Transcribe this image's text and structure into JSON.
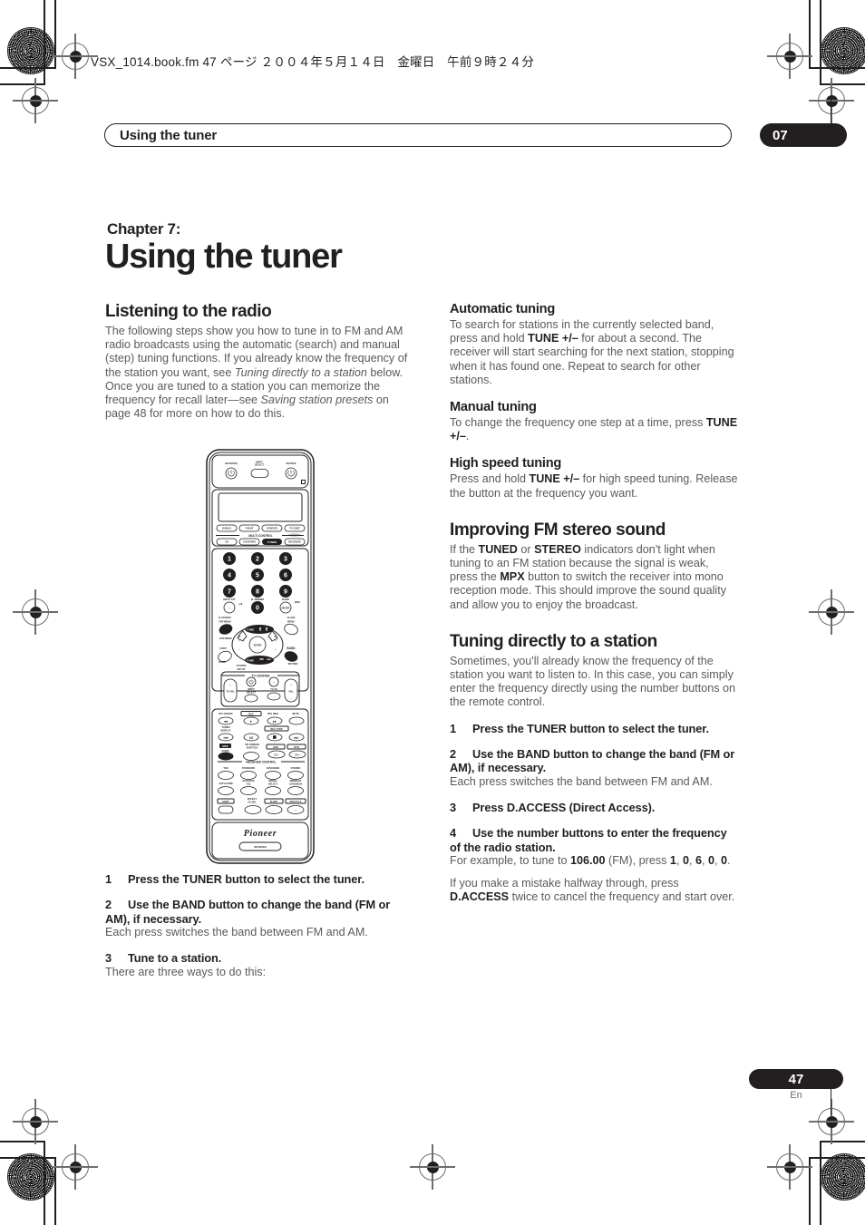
{
  "slug": {
    "text": "VSX_1014.book.fm  47 ページ  ２００４年５月１４日　金曜日　午前９時２４分"
  },
  "running_head": {
    "title": "Using the tuner",
    "chapter_number": "07"
  },
  "chapter": {
    "label": "Chapter 7:",
    "title": "Using the tuner"
  },
  "left_column": {
    "section_heading": "Listening to the radio",
    "intro_1": "The following steps show you how to tune in to FM and AM radio broadcasts using the automatic (search) and manual (step) tuning functions. If you already know the frequency of the station you want, see ",
    "intro_italic_1": "Tuning directly to a station",
    "intro_2": " below. Once you are tuned to a station you can memorize the frequency for recall later—see ",
    "intro_italic_2": "Saving station presets",
    "intro_3": " on page 48 for more on how to do this.",
    "steps": [
      {
        "num": "1",
        "heading": "Press the TUNER button to select the tuner.",
        "body": ""
      },
      {
        "num": "2",
        "heading": "Use the BAND button to change the band (FM or AM), if necessary.",
        "body": "Each press switches the band between FM and AM."
      },
      {
        "num": "3",
        "heading": "Tune to a station.",
        "body": "There are three ways to do this:"
      }
    ]
  },
  "right_column": {
    "automatic_tuning": {
      "heading": "Automatic tuning",
      "body_1": "To search for stations in the currently selected band, press and hold ",
      "bold_1": "TUNE +/–",
      "body_2": " for about a second. The receiver will start searching for the next station, stopping when it has found one. Repeat to search for other stations."
    },
    "manual_tuning": {
      "heading": "Manual tuning",
      "body_1": "To change the frequency one step at a time, press ",
      "bold_1": "TUNE +/–",
      "body_2": "."
    },
    "high_speed_tuning": {
      "heading": "High speed tuning",
      "body_1": "Press and hold ",
      "bold_1": "TUNE +/–",
      "body_2": " for high speed tuning. Release the button at the frequency you want."
    },
    "improving_fm": {
      "heading": "Improving FM stereo sound",
      "body_1": "If the ",
      "bold_1": "TUNED",
      "body_2": " or ",
      "bold_2": "STEREO",
      "body_3": " indicators don't light when tuning to an FM station because the signal is weak, press the ",
      "bold_3": "MPX",
      "body_4": " button to switch the receiver into mono reception mode. This should improve the sound quality and allow you to enjoy the broadcast."
    },
    "tuning_directly": {
      "heading": "Tuning directly to a station",
      "body": "Sometimes, you'll already know the frequency of the station you want to listen to. In this case, you can simply enter the frequency directly using the number buttons on the remote control."
    },
    "steps": [
      {
        "num": "1",
        "heading": "Press the TUNER button to select the tuner.",
        "body": ""
      },
      {
        "num": "2",
        "heading": "Use the BAND button to change the band (FM or AM), if necessary.",
        "body": "Each press switches the band between FM and AM."
      },
      {
        "num": "3",
        "heading": "Press D.ACCESS (Direct Access).",
        "body": ""
      },
      {
        "num": "4",
        "heading": "Use the number buttons to enter the frequency of the radio station.",
        "body": ""
      }
    ],
    "example": {
      "pre": "For example, to tune to ",
      "freq": "106.00",
      "mid": " (FM), press ",
      "d1": "1",
      "s1": ", ",
      "d2": "0",
      "s2": ", ",
      "d3": "6",
      "s3": ", ",
      "d4": "0",
      "s4": ", ",
      "d5": "0",
      "end": "."
    },
    "mistake": {
      "pre": "If you make a mistake halfway through, press ",
      "bold": "D.ACCESS",
      "post": " twice to cancel the frequency and start over."
    }
  },
  "remote": {
    "alt": "Pioneer receiver remote control illustration",
    "top_labels": {
      "receiver": "RECEIVER",
      "input_select": "INPUT SELECT",
      "source": "SOURCE"
    },
    "source_buttons": [
      "DVD/LD",
      "TV/SAT",
      "DVR/VCR",
      "TV CONT"
    ],
    "multi_control_label": "MULTI CONTROL",
    "multi_buttons": [
      "CD",
      "CD-R/TAPE",
      "TUNER",
      "RECEIVER"
    ],
    "multi_selected": "TUNER",
    "numbers": [
      "1",
      "2",
      "3",
      "4",
      "5",
      "6",
      "7",
      "8",
      "9",
      "0"
    ],
    "aux_labels": {
      "input_att": "INPUT ATT",
      "fl_dimmer": "FL DIMMER",
      "sleep": "SLEEP",
      "plus10": "+10",
      "disc": "DISC",
      "enter": "ENTER",
      "class": "CLASS"
    },
    "nav_labels": {
      "tune_up": "TUNE +",
      "tune_down": "TUNE –",
      "st_left": "ST",
      "st_right": "ST",
      "enter": "ENTER",
      "d_access": "D.ACCESS",
      "top_menu": "TOP MENU",
      "band": "BAND",
      "menu": "MENU",
      "dvd_menu": "DVD MENU",
      "t_edit": "T.EDIT",
      "return": "RETURN",
      "guide": "GUIDE",
      "system_setup": "SYSTEM SETUP"
    },
    "tv_control": {
      "label": "TV CONTROL",
      "tvvol": "TV VOL",
      "input_select": "INPUT SELECT",
      "tv_ch": "TV CH",
      "vol": "VOL"
    },
    "transport_labels": [
      "DTV ON/OFF",
      "REC",
      "DTV INFO",
      "MUTE",
      "TUNER DISPLAY",
      "REC STOP",
      "MPX AUDIO",
      "ON SCREEN SUBTITLE",
      "HDD",
      "DVD"
    ],
    "receiver_control_label": "RECEIVER CONTROL",
    "receiver_buttons": [
      "THX",
      "STANDARD",
      "ADVANCED",
      "STEREO",
      "AUTO SURR",
      "ACOUSTIC EQ",
      "SIGNAL SELECT",
      "MIDNIGHT LOUDNESS",
      "SHIFT",
      "EFFECT CH SEL",
      "SLEEP",
      "DISC/LS S"
    ],
    "brand": "Pioneer",
    "model_badge": "RECEIVER"
  },
  "footer": {
    "page": "47",
    "lang": "En"
  },
  "colors": {
    "ink": "#231f20",
    "body_gray": "#5a5a5a",
    "reg_gray": "#6d6d6d"
  }
}
